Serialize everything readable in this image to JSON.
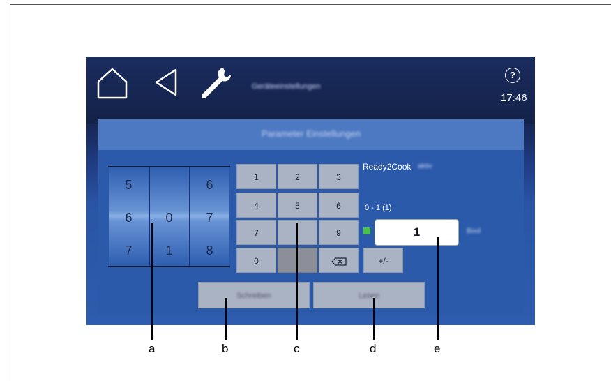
{
  "topbar": {
    "icons": [
      "home-icon",
      "back-icon",
      "wrench-icon",
      "help-icon"
    ],
    "title": "Geräteeinstellungen",
    "clock": "17:46"
  },
  "panel": {
    "title": "Parameter Einstellungen"
  },
  "drum": {
    "left": [
      "5",
      "6",
      "7"
    ],
    "middle": [
      "",
      "0",
      "1"
    ],
    "right": [
      "6",
      "7",
      "8"
    ]
  },
  "keypad": {
    "rows": [
      [
        "1",
        "2",
        "3"
      ],
      [
        "4",
        "5",
        "6"
      ],
      [
        "7",
        "",
        "9"
      ],
      [
        "0",
        "",
        "",
        "+/-"
      ]
    ]
  },
  "parameter": {
    "name": "Ready2Cook",
    "name_suffix": "aktiv",
    "range": "0 - 1 (1)",
    "value": "1",
    "unit": "Bool",
    "indicator_color": "#49c24a"
  },
  "buttons": {
    "write": "Schreiben",
    "read": "Lesen"
  },
  "callouts": [
    "a",
    "b",
    "c",
    "d",
    "e"
  ],
  "colors": {
    "topbar": "#16254f",
    "panel": "#2c5aab",
    "key": "#aab3c4"
  }
}
